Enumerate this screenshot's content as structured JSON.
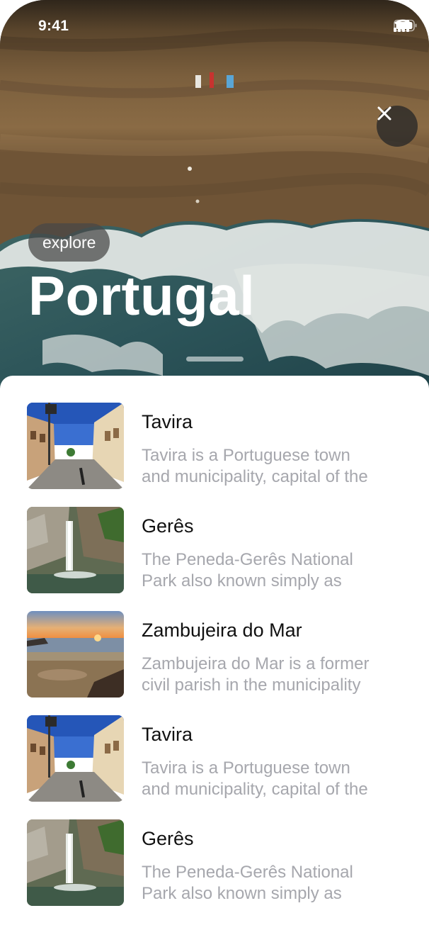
{
  "status_bar": {
    "time": "9:41"
  },
  "hero": {
    "chip_label": "explore",
    "title": "Portugal"
  },
  "places": [
    {
      "name": "Tavira",
      "description_line1": "Tavira is a Portuguese town",
      "description_line2": "and municipality, capital of the",
      "thumbnail": "street"
    },
    {
      "name": "Gerês",
      "description_line1": "The Peneda-Gerês National",
      "description_line2": "Park also known simply as",
      "thumbnail": "waterfall"
    },
    {
      "name": "Zambujeira do Mar",
      "description_line1": "Zambujeira do Mar is a former",
      "description_line2": "civil parish in the municipality",
      "thumbnail": "beach-sunset"
    },
    {
      "name": "Tavira",
      "description_line1": "Tavira is a Portuguese town",
      "description_line2": "and municipality, capital of the",
      "thumbnail": "street"
    },
    {
      "name": "Gerês",
      "description_line1": "The Peneda-Gerês National",
      "description_line2": "Park also known simply as",
      "thumbnail": "waterfall"
    }
  ]
}
